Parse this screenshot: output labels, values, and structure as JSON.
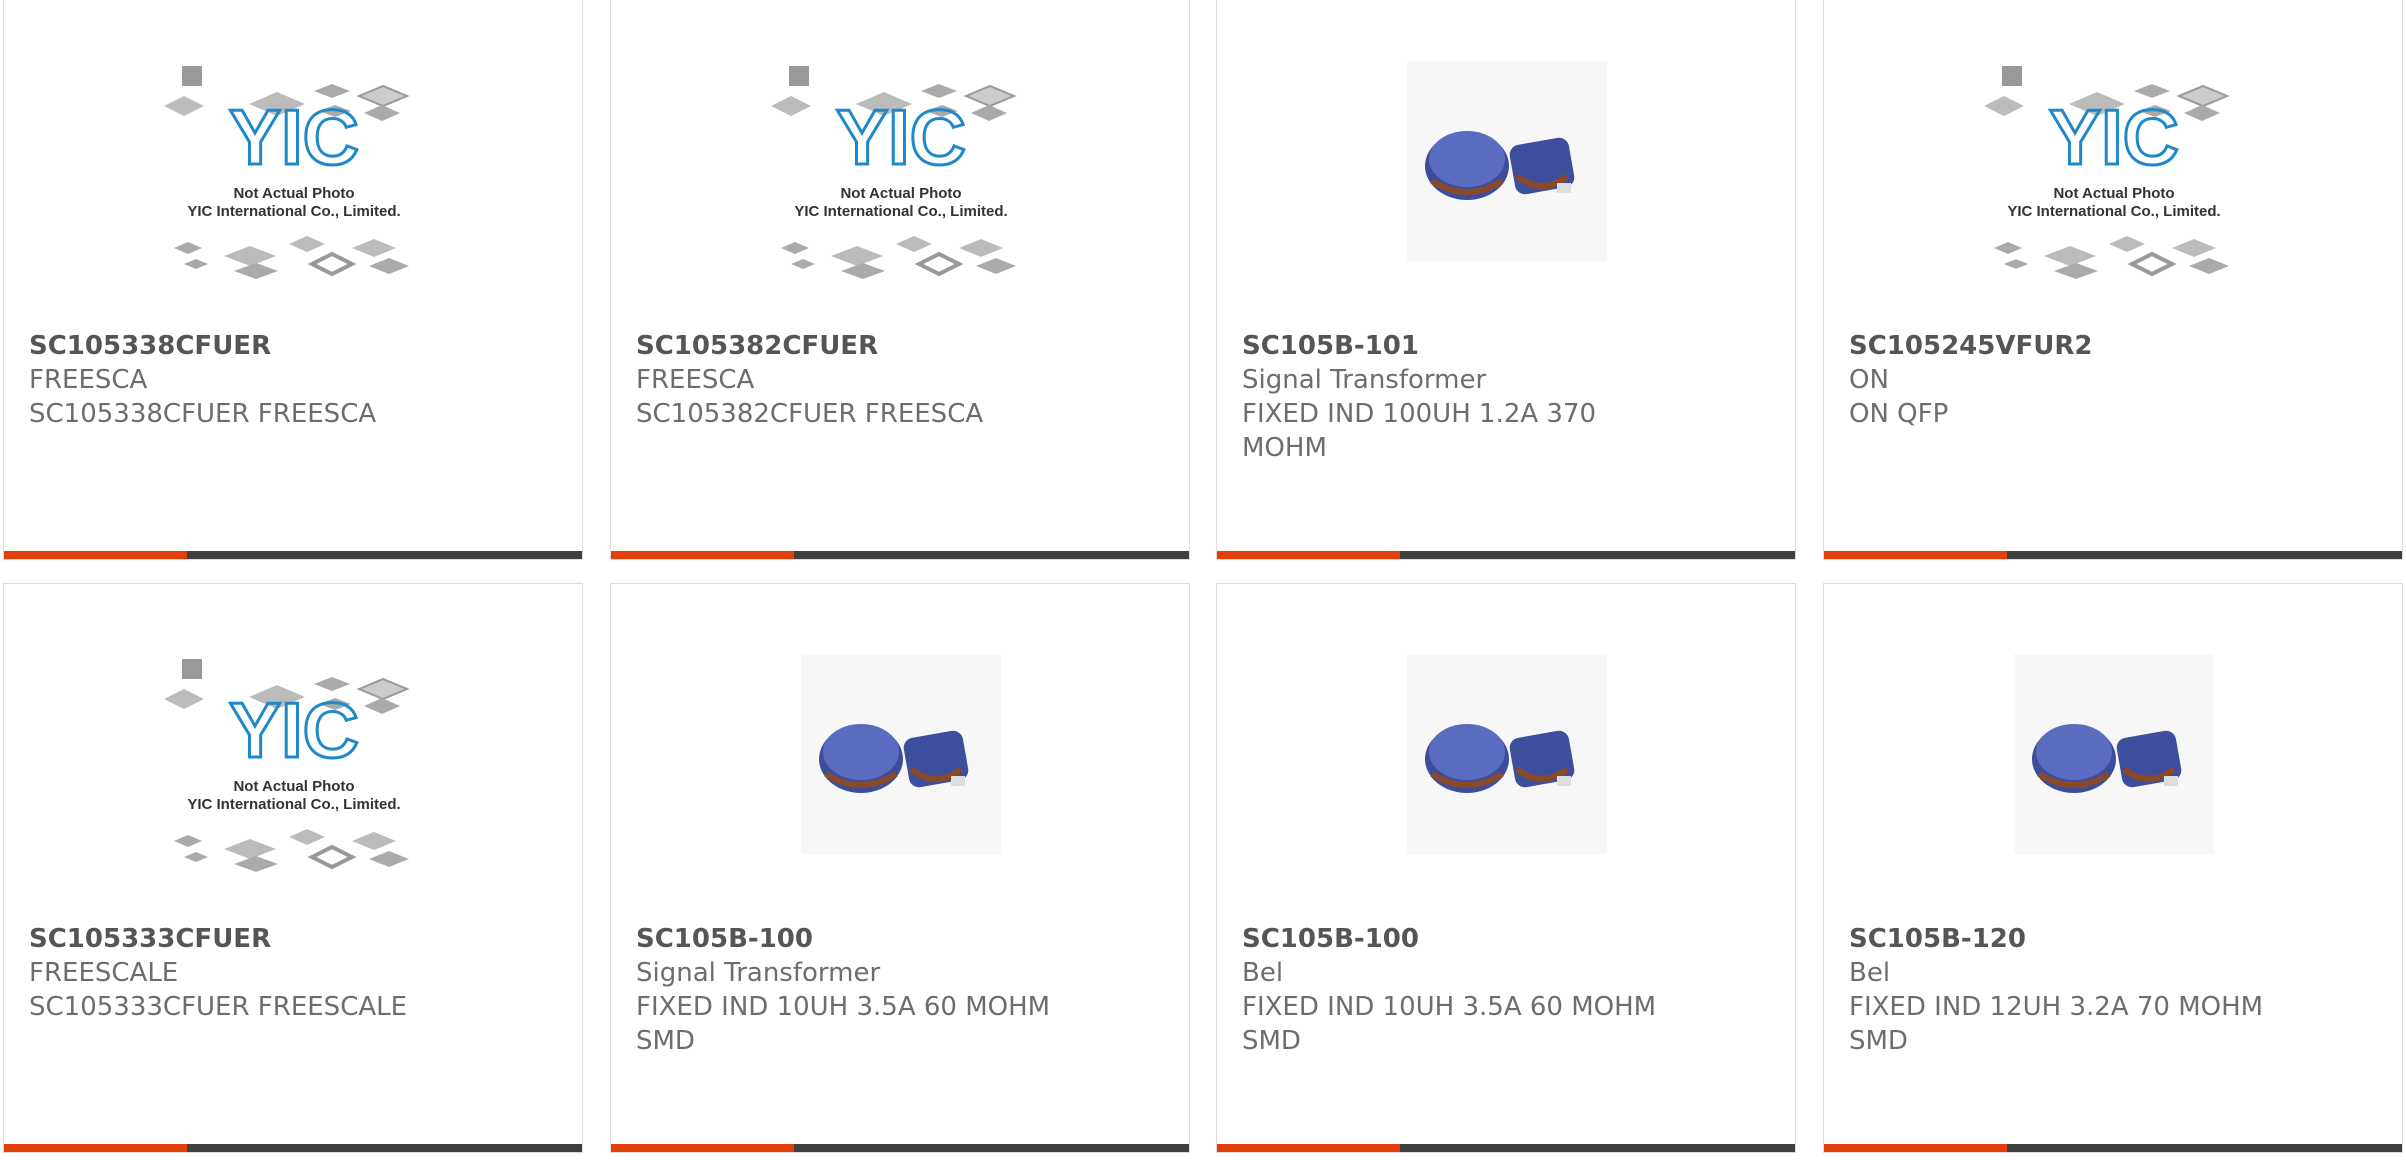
{
  "products": [
    {
      "part": "SC105338CFUER",
      "brand": "FREESCA",
      "desc": "SC105338CFUER FREESCA",
      "image": "yic-placeholder-icon"
    },
    {
      "part": "SC105382CFUER",
      "brand": "FREESCA",
      "desc": "SC105382CFUER FREESCA",
      "image": "yic-placeholder-icon"
    },
    {
      "part": "SC105B-101",
      "brand": "Signal Transformer",
      "desc": "FIXED IND 100UH 1.2A 370 MOHM",
      "image": "inductor-photo"
    },
    {
      "part": "SC105245VFUR2",
      "brand": "ON",
      "desc": "ON QFP",
      "image": "yic-placeholder-icon"
    },
    {
      "part": "SC105333CFUER",
      "brand": "FREESCALE",
      "desc": "SC105333CFUER FREESCALE",
      "image": "yic-placeholder-icon"
    },
    {
      "part": "SC105B-100",
      "brand": "Signal Transformer",
      "desc": "FIXED IND 10UH 3.5A 60 MOHM SMD",
      "image": "inductor-photo"
    },
    {
      "part": "SC105B-100",
      "brand": "Bel",
      "desc": "FIXED IND 10UH 3.5A 60 MOHM SMD",
      "image": "inductor-photo"
    },
    {
      "part": "SC105B-120",
      "brand": "Bel",
      "desc": "FIXED IND 12UH 3.2A 70 MOHM SMD",
      "image": "inductor-photo"
    }
  ],
  "placeholder": {
    "logo_text": "YIC",
    "line1": "Not Actual Photo",
    "line2": "YIC International Co., Limited."
  },
  "colors": {
    "accent": "#e2400b",
    "bar": "#3f3f3f",
    "title": "#555555",
    "text": "#6d6d6d",
    "logo": "#1e88c8"
  }
}
